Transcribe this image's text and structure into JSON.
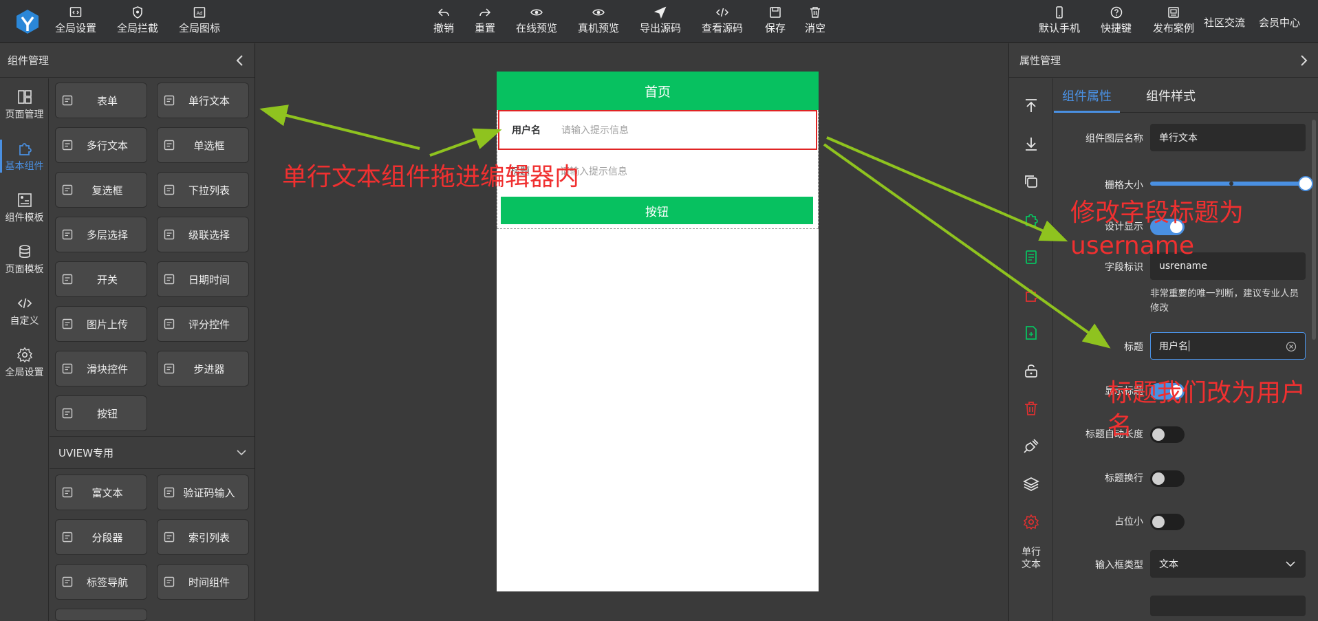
{
  "toolbar": {
    "left": [
      {
        "label": "全局设置",
        "icon": "code-box-icon"
      },
      {
        "label": "全局拦截",
        "icon": "shield-icon"
      },
      {
        "label": "全局图标",
        "icon": "ad-box-icon"
      }
    ],
    "center": [
      {
        "label": "撤销",
        "icon": "undo-icon"
      },
      {
        "label": "重置",
        "icon": "redo-icon"
      },
      {
        "label": "在线预览",
        "icon": "eye-icon"
      },
      {
        "label": "真机预览",
        "icon": "eye-icon"
      },
      {
        "label": "导出源码",
        "icon": "send-icon"
      },
      {
        "label": "查看源码",
        "icon": "code-icon"
      },
      {
        "label": "保存",
        "icon": "save-icon"
      },
      {
        "label": "消空",
        "icon": "trash-icon"
      }
    ],
    "right": [
      {
        "label": "默认手机",
        "icon": "phone-icon"
      },
      {
        "label": "快捷键",
        "icon": "help-icon"
      },
      {
        "label": "发布案例",
        "icon": "image-box-icon"
      },
      {
        "label": "社区交流"
      },
      {
        "label": "会员中心"
      }
    ]
  },
  "left_panel": {
    "title": "组件管理",
    "nav": [
      {
        "label": "页面管理",
        "icon": "layout-icon"
      },
      {
        "label": "基本组件",
        "icon": "puzzle-icon",
        "active": true
      },
      {
        "label": "组件模板",
        "icon": "template-icon"
      },
      {
        "label": "页面模板",
        "icon": "database-icon"
      },
      {
        "label": "自定义",
        "icon": "code-icon"
      },
      {
        "label": "全局设置",
        "icon": "gear-icon"
      }
    ],
    "components": [
      {
        "label": "表单",
        "icon": "form-icon"
      },
      {
        "label": "单行文本",
        "icon": "input-icon"
      },
      {
        "label": "多行文本",
        "icon": "textarea-icon"
      },
      {
        "label": "单选框",
        "icon": "radio-icon"
      },
      {
        "label": "复选框",
        "icon": "checkbox-icon"
      },
      {
        "label": "下拉列表",
        "icon": "select-icon"
      },
      {
        "label": "多层选择",
        "icon": "select-icon"
      },
      {
        "label": "级联选择",
        "icon": "cascade-icon"
      },
      {
        "label": "开关",
        "icon": "switch-icon"
      },
      {
        "label": "日期时间",
        "icon": "calendar-icon"
      },
      {
        "label": "图片上传",
        "icon": "image-icon"
      },
      {
        "label": "评分控件",
        "icon": "star-icon"
      },
      {
        "label": "滑块控件",
        "icon": "slider-icon"
      },
      {
        "label": "步进器",
        "icon": "stepper-icon"
      },
      {
        "label": "按钮",
        "icon": "button-icon"
      }
    ],
    "section_title": "UVIEW专用",
    "uview_components": [
      {
        "label": "富文本",
        "icon": "richtext-icon"
      },
      {
        "label": "验证码输入",
        "icon": "code-input-icon"
      },
      {
        "label": "分段器",
        "icon": "list-icon"
      },
      {
        "label": "索引列表",
        "icon": "list-icon"
      },
      {
        "label": "标签导航",
        "icon": "folder-icon"
      },
      {
        "label": "时间组件",
        "icon": "calendar-icon"
      }
    ]
  },
  "phone": {
    "title": "首页",
    "row1": {
      "label": "用户名",
      "placeholder": "请输入提示信息"
    },
    "row2": {
      "label": "标题",
      "placeholder": "请输入提示信息"
    },
    "button_label": "按钮"
  },
  "right_panel": {
    "title": "属性管理",
    "tools_label": "单行\n文本",
    "tabs": [
      "组件属性",
      "组件样式"
    ],
    "props": {
      "layer_name_label": "组件图层名称",
      "layer_name_value": "单行文本",
      "grid_size_label": "栅格大小",
      "grid_size_value": 1.0,
      "design_show_label": "设计显示",
      "field_id_label": "字段标识",
      "field_id_value": "usrename",
      "field_id_hint": "非常重要的唯一判断，建议专业人员修改",
      "title_label": "标题",
      "title_value": "用户名",
      "show_title_label": "显示标题",
      "title_auto_width_label": "标题自动长度",
      "title_wrap_label": "标题换行",
      "placeholder_small_label": "占位小",
      "input_type_label": "输入框类型",
      "input_type_value": "文本"
    }
  },
  "annotations": {
    "drag_note": "单行文本组件拖进编辑器内",
    "field_note_line1": "修改字段标题为",
    "field_note_line2": "username",
    "title_note_line1": "标题我们改为用户",
    "title_note_line2": "名"
  },
  "colors": {
    "accent": "#4a90e2",
    "green": "#07c160",
    "annotation": "#f03030",
    "arrow": "#8fc31f"
  }
}
